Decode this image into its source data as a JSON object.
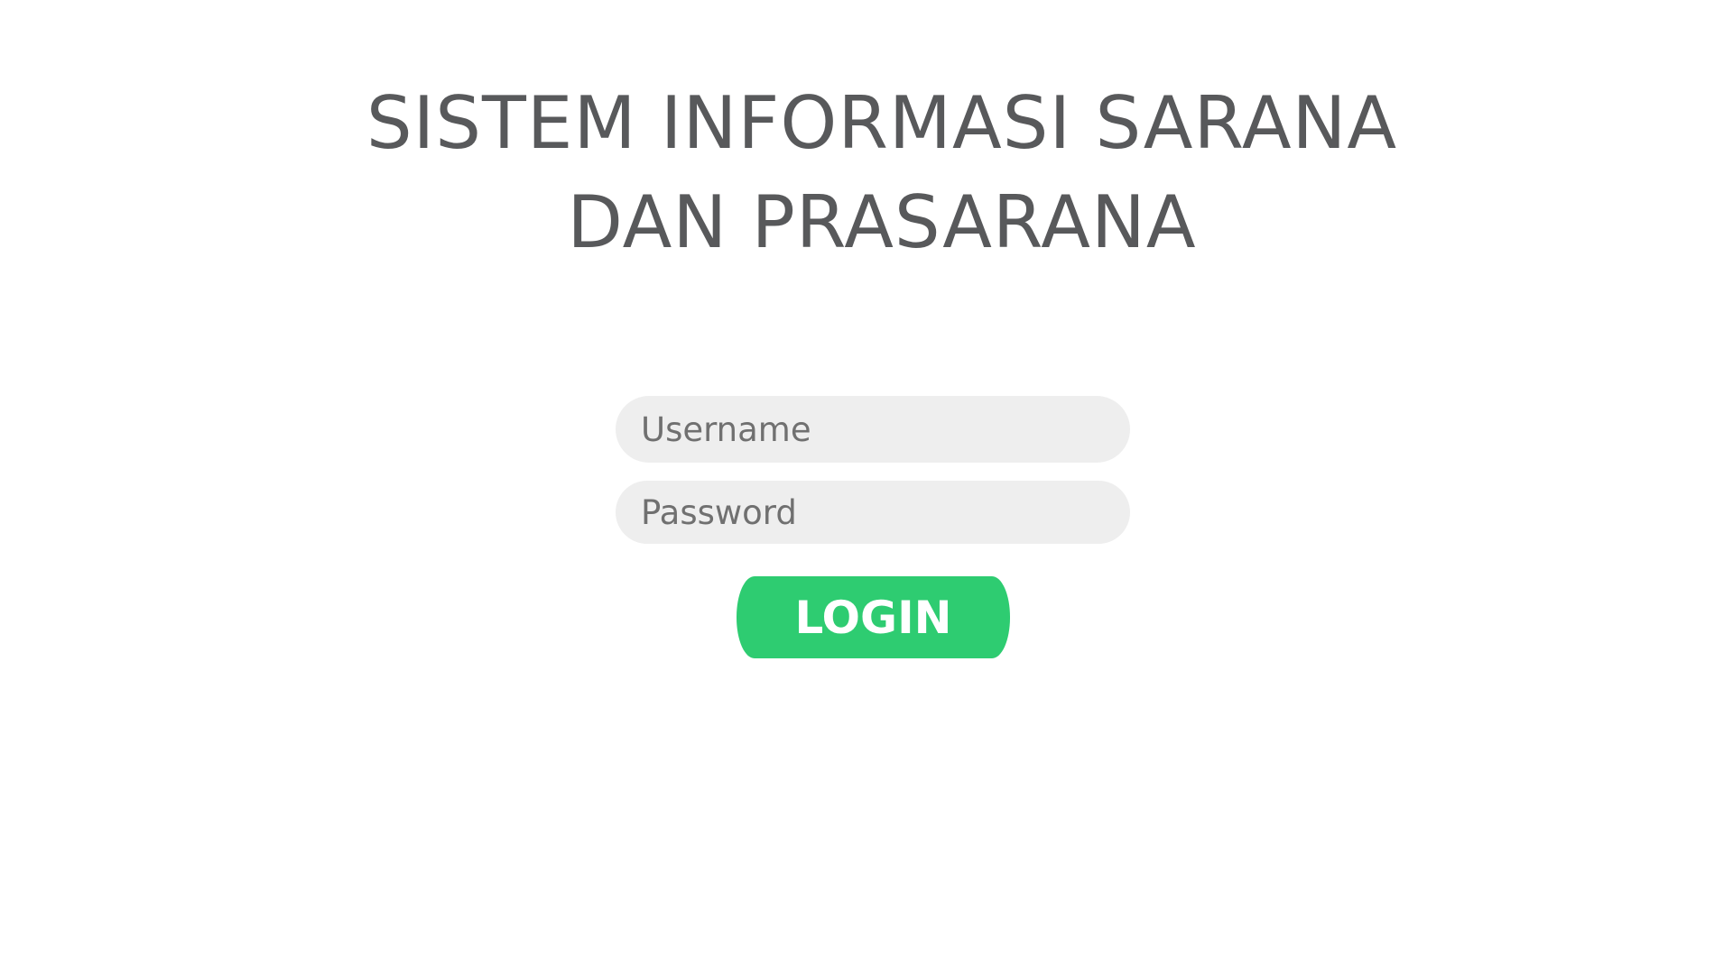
{
  "header": {
    "title_line_1": "SISTEM INFORMASI SARANA",
    "title_line_2": "DAN PRASARANA"
  },
  "login": {
    "username_placeholder": "Username",
    "password_placeholder": "Password",
    "button_label": "LOGIN"
  },
  "colors": {
    "background": "#ffffff",
    "title_text": "#58595b",
    "input_background": "#eeeeee",
    "placeholder_text": "#707070",
    "button_background": "#2ecc71",
    "button_text": "#ffffff"
  }
}
